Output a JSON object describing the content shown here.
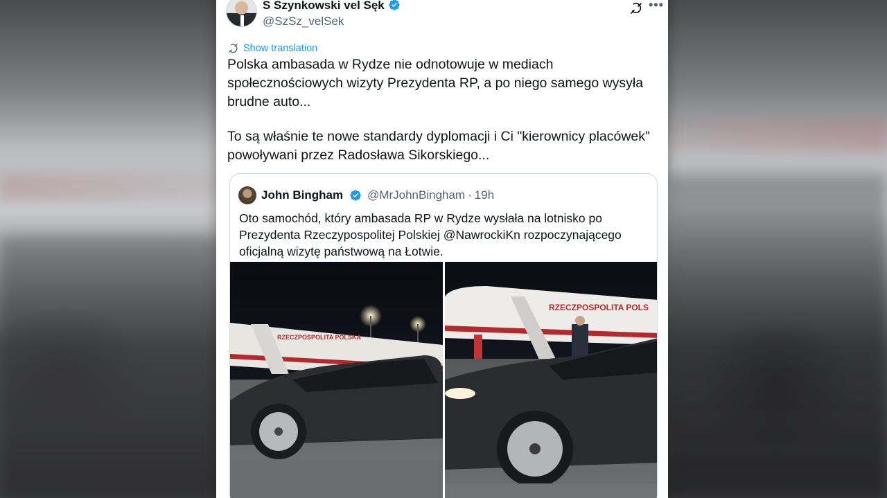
{
  "author": {
    "name": "S Szynkowski vel Sęk",
    "handle": "@SzSz_velSek",
    "verified": true
  },
  "translation": {
    "label": "Show translation"
  },
  "tweet": {
    "paragraph1": "Polska ambasada w Rydze nie odnotowuje w mediach społecznościowych wizyty Prezydenta RP, a po niego samego wysyła brudne auto...",
    "paragraph2": "To są właśnie te nowe standardy dyplomacji i Ci \"kierownicy placówek\" powoływani przez Radosława Sikorskiego..."
  },
  "quote": {
    "name": "John Bingham",
    "handle": "@MrJohnBingham",
    "separator": "·",
    "time": "19h",
    "text": "Oto samochód, który ambasada RP w Rydze wysłała na lotnisko po Prezydenta Rzeczypospolitej Polskiej @NawrockiKn rozpoczynającego oficjalną wizytę państwową na Łotwie.",
    "photos": [
      {
        "plane_text": "RZECZPOSPOLITA POLSKA"
      },
      {
        "plane_text": "RZECZPOSPOLITA POLS"
      }
    ]
  },
  "colors": {
    "accent": "#1d9bf0",
    "text": "#0f1419",
    "secondary": "#536471"
  },
  "icons": {
    "verified": "verified-badge-icon",
    "grok": "grok-icon",
    "more": "more-icon",
    "translate": "translate-icon"
  }
}
